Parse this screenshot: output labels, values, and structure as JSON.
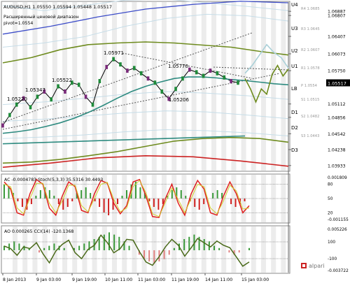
{
  "header": {
    "symbol_line": "AUDUSD,H1  1.05550 1.05594 1.05448 1.05517",
    "pivot_caption": "Расширенный ценовой диапазон",
    "pivot_value": "pivot=1.0554"
  },
  "watermark": "alpari",
  "chart_data": [
    {
      "type": "line",
      "panel": "price",
      "x": [
        "8 Jan 2013",
        "9 Jan 03:00",
        "9 Jan 19:00",
        "10 Jan 11:00",
        "11 Jan 03:00",
        "11 Jan 19:00",
        "14 Jan 11:00",
        "15 Jan 03:00"
      ],
      "ylim": [
        1.0385,
        1.0705
      ],
      "y_ticks": [
        "1.06887",
        "1.06807",
        "1.06407",
        "1.06073",
        "1.05750",
        "1.05517",
        "1.05112",
        "1.04856",
        "1.04542",
        "1.04238",
        "1.03933"
      ],
      "current_price": "1.05517",
      "level_labels": [
        "U4",
        "U3",
        "U2",
        "U1",
        "LB",
        "D1",
        "D2",
        "D3"
      ],
      "pivot_labels": [
        "R4 1.0685",
        "R3 1.0645",
        "R2 1.0607",
        "R1 1.0578",
        "P 1.0554",
        "S1 1.0515",
        "S2 1.0482",
        "S3 1.0443"
      ],
      "annotations": [
        "1.05220",
        "1.05347",
        "1.05522",
        "1.05971",
        "1.05770",
        "1.05206"
      ],
      "series": [
        {
          "color": "#000000",
          "values": [
            1.047,
            1.049,
            1.051,
            1.0522,
            1.0505,
            1.0525,
            1.0535,
            1.052,
            1.0545,
            1.0535,
            1.0552,
            1.0548,
            1.0525,
            1.051,
            1.0555,
            1.0582,
            1.0597,
            1.0587,
            1.0575,
            1.058,
            1.057,
            1.056,
            1.0552,
            1.0535,
            1.0521,
            1.054,
            1.056,
            1.0577,
            1.0572,
            1.0565,
            1.0575,
            1.057,
            1.0562,
            1.0555,
            1.0552
          ]
        },
        {
          "color": "#2e8b80",
          "values": [
            1.0455,
            1.0458,
            1.0462,
            1.0468,
            1.0475,
            1.0484,
            1.0495,
            1.0508,
            1.0522,
            1.0535,
            1.0545,
            1.0553,
            1.056,
            1.0563,
            1.0563,
            1.0561,
            1.0558,
            1.0556,
            1.0553,
            1.055,
            1.0548
          ]
        },
        {
          "color": "#6e8b1e",
          "values": [
            1.059,
            1.06,
            1.0615,
            1.0625,
            1.0628,
            1.063,
            1.0628,
            1.0624,
            1.062,
            1.0612,
            1.0605
          ]
        },
        {
          "color": "#6e8b1e",
          "values": [
            1.0398,
            1.04,
            1.0405,
            1.0412,
            1.042,
            1.043,
            1.044,
            1.0445,
            1.0447,
            1.0445,
            1.0438
          ]
        },
        {
          "color": "#2e8b80",
          "values": [
            1.0435,
            1.0438,
            1.0441,
            1.0444,
            1.0447,
            1.045
          ]
        },
        {
          "color": "#6e8b1e",
          "values": [
            1.056,
            1.054,
            1.0515,
            1.054,
            1.053,
            1.0568,
            1.0585,
            1.0565,
            1.0578
          ]
        },
        {
          "color": "#aad0d8",
          "values": [
            1.057,
            1.0585,
            1.0605,
            1.0625,
            1.061,
            1.06,
            1.058
          ]
        },
        {
          "color": "#cc2222",
          "values": [
            1.039,
            1.0398,
            1.0408,
            1.0412,
            1.041,
            1.0402,
            1.0392
          ]
        }
      ]
    },
    {
      "type": "bar",
      "panel": "AC / Stoch",
      "title": "AC -0.0004783  Stoch(5,3,3) 35.5316 30.4493",
      "y_ticks": [
        "0.001809",
        "80",
        "50",
        "20",
        "-0.001155"
      ],
      "series": [
        {
          "name": "AC",
          "values": [
            5,
            4,
            2,
            -1,
            -3,
            -4,
            -2,
            1,
            3,
            4,
            3,
            1,
            -2,
            -4,
            -3,
            -1,
            2,
            3,
            4,
            2,
            -1,
            -3,
            -5,
            -6,
            -4,
            -2,
            1,
            3,
            5,
            6,
            4,
            2,
            -1,
            -3,
            -4,
            -2,
            1,
            3,
            4,
            3,
            1,
            -1,
            -3,
            -4,
            -2,
            0,
            2,
            3,
            2,
            0,
            -2,
            -3,
            -2,
            -1,
            0
          ]
        },
        {
          "name": "Stoch",
          "values": [
            85,
            70,
            20,
            15,
            60,
            90,
            80,
            30,
            15,
            55,
            85,
            75,
            25,
            20,
            60,
            88,
            82,
            40,
            18,
            35,
            85,
            90,
            55,
            12,
            10,
            50,
            80,
            40,
            15,
            60,
            88,
            70,
            20,
            15,
            55,
            85,
            60,
            20,
            35
          ]
        },
        {
          "name": "Signal",
          "values": [
            80,
            75,
            30,
            18,
            50,
            82,
            82,
            40,
            20,
            45,
            78,
            78,
            35,
            22,
            50,
            80,
            84,
            48,
            22,
            30,
            75,
            88,
            62,
            18,
            12,
            42,
            72,
            48,
            20,
            50,
            80,
            75,
            30,
            18,
            45,
            78,
            66,
            28,
            30
          ]
        }
      ]
    },
    {
      "type": "bar",
      "panel": "AO / CCI",
      "title": "AO 0.000265  CCI(14) -120.1368",
      "y_ticks": [
        "0.005226",
        "100",
        "-100",
        "-0.003722"
      ],
      "series": [
        {
          "name": "AO",
          "values": [
            2,
            3,
            4,
            3,
            2,
            1,
            0,
            -1,
            1,
            2,
            3,
            2,
            1,
            0,
            1,
            2,
            3,
            4,
            5,
            6,
            7,
            8,
            7,
            6,
            4,
            2,
            0,
            -2,
            -4,
            -5,
            -6,
            -5,
            -4,
            -2,
            1,
            3,
            5,
            6,
            7,
            6,
            5,
            4,
            2,
            1,
            0,
            -1,
            -2,
            -1,
            0,
            1
          ]
        },
        {
          "name": "CCI",
          "values": [
            50,
            20,
            -60,
            40,
            20,
            90,
            -40,
            -150,
            -10,
            70,
            120,
            -30,
            -100,
            10,
            60,
            180,
            90,
            -30,
            20,
            130,
            120,
            -20,
            -140,
            -180,
            -80,
            40,
            130,
            60,
            -70,
            30,
            140,
            90,
            40,
            110,
            60,
            30,
            -80,
            -190,
            -140
          ]
        }
      ]
    }
  ]
}
